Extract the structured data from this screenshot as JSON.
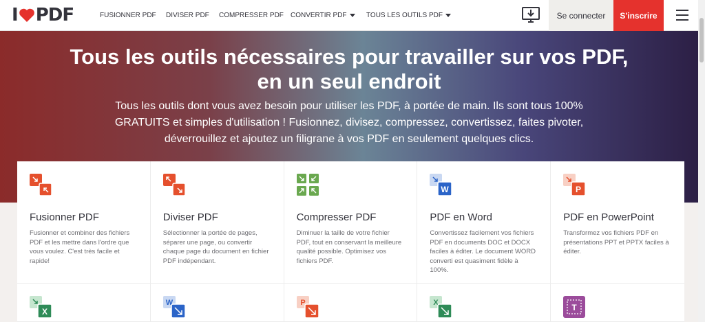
{
  "brand": {
    "logo_i": "I",
    "logo_pdf": "PDF"
  },
  "nav": [
    {
      "label": "FUSIONNER PDF",
      "caret": false
    },
    {
      "label": "DIVISER PDF",
      "caret": false
    },
    {
      "label": "COMPRESSER PDF",
      "caret": false
    },
    {
      "label": "CONVERTIR PDF",
      "caret": true
    },
    {
      "label": "TOUS LES OUTILS PDF",
      "caret": true
    }
  ],
  "auth": {
    "login": "Se connecter",
    "signup": "S'inscrire"
  },
  "hero": {
    "title_line1": "Tous les outils nécessaires pour travailler sur vos PDF,",
    "title_line2": "en un seul endroit",
    "subtitle": "Tous les outils dont vous avez besoin pour utiliser les PDF, à portée de main. Ils sont tous 100% GRATUITS et simples d'utilisation ! Fusionnez, divisez, compressez, convertissez, faites pivoter, déverrouillez et ajoutez un filigrane à vos PDF en seulement quelques clics."
  },
  "tools": [
    {
      "title": "Fusionner PDF",
      "desc": "Fusionner et combiner des fichiers PDF et les mettre dans l'ordre que vous voulez. C'est très facile et rapide!",
      "icon": "merge-icon"
    },
    {
      "title": "Diviser PDF",
      "desc": "Sélectionner la portée de pages, séparer une page, ou convertir chaque page du document en fichier PDF indépendant.",
      "icon": "split-icon"
    },
    {
      "title": "Compresser PDF",
      "desc": "Diminuer la taille de votre fichier PDF, tout en conservant la meilleure qualité possible. Optimisez vos fichiers PDF.",
      "icon": "compress-icon"
    },
    {
      "title": "PDF en Word",
      "desc": "Convertissez facilement vos fichiers PDF en documents DOC et DOCX faciles à éditer. Le document WORD converti est quasiment fidèle à 100%.",
      "icon": "pdf-to-word-icon"
    },
    {
      "title": "PDF en PowerPoint",
      "desc": "Transformez vos fichiers PDF en présentations PPT et PPTX faciles à éditer.",
      "icon": "pdf-to-powerpoint-icon"
    }
  ],
  "tools_row2": [
    {
      "icon": "pdf-to-excel-icon",
      "letter": "X"
    },
    {
      "icon": "word-to-pdf-icon",
      "letter": "W"
    },
    {
      "icon": "powerpoint-to-pdf-icon",
      "letter": "P"
    },
    {
      "icon": "excel-to-pdf-icon",
      "letter": "X"
    },
    {
      "icon": "edit-pdf-icon",
      "letter": "T"
    }
  ],
  "colors": {
    "brand_red": "#e5322d",
    "text": "#33333b",
    "word_blue": "#2b64c8",
    "excel_green": "#2e8b57",
    "ppt_orange": "#e5502d",
    "edit_purple": "#9b4c9b"
  }
}
